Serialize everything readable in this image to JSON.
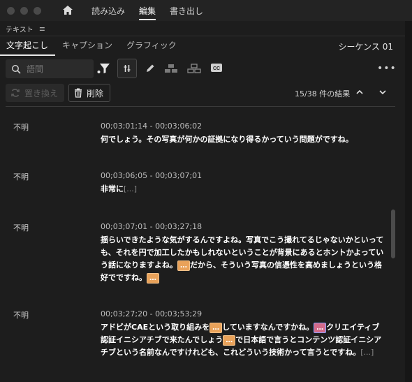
{
  "topnav": {
    "items": [
      "読み込み",
      "編集",
      "書き出し"
    ],
    "active": 1
  },
  "panel": {
    "title": "テキスト",
    "menu_icon": "hamburger-icon"
  },
  "tabs": [
    "文字起こし",
    "キャプション",
    "グラフィック"
  ],
  "sequence": "シーケンス 01",
  "search": {
    "value": "",
    "placeholder": "語間"
  },
  "actions": {
    "replace_label": "置き換え",
    "delete_label": "削除",
    "results": "15/38 件の結果"
  },
  "entries": [
    {
      "speaker": "不明",
      "timecode": "00;03;01;14 - 00;03;06;02",
      "segments": [
        {
          "t": "何でしょう。その写真が何かの証拠になり得るかっていう問題がですね。"
        }
      ]
    },
    {
      "speaker": "不明",
      "timecode": "00;03;06;05 - 00;03;07;01",
      "segments": [
        {
          "t": "非常に"
        },
        {
          "t": "[...]",
          "type": "ell"
        }
      ]
    },
    {
      "speaker": "不明",
      "timecode": "00;03;07;01 - 00;03;27;18",
      "segments": [
        {
          "t": "揺らいできたような気がするんですよね。写真でこう撮れてるじゃないかといっても、それを円で加工したかもしれないということが背景にあるとホントかよっていう話になりますよね。"
        },
        {
          "t": "…",
          "type": "chip"
        },
        {
          "t": "だから、そういう写真の信憑性を高めましょうという格好でですね。"
        },
        {
          "t": "…",
          "type": "chip"
        }
      ]
    },
    {
      "speaker": "不明",
      "timecode": "00;03;27;20 - 00;03;53;29",
      "segments": [
        {
          "t": "アドビがCAEという取り組みを"
        },
        {
          "t": "…",
          "type": "chip"
        },
        {
          "t": "していますなんですかね。"
        },
        {
          "t": "…",
          "type": "chip pink"
        },
        {
          "t": "クリエイティブ認証イニシアチブで来たんでしょう"
        },
        {
          "t": "…",
          "type": "chip"
        },
        {
          "t": "で日本語で言うとコンテンツ認証イニシアチブという名前なんですけれども、これどういう技術かって言うとですね。"
        },
        {
          "t": "[...]",
          "type": "ell"
        }
      ]
    }
  ],
  "colors": {
    "background": "#1d1d1d",
    "chip": "#e9a25a",
    "chip_alt": "#d36a8a"
  }
}
